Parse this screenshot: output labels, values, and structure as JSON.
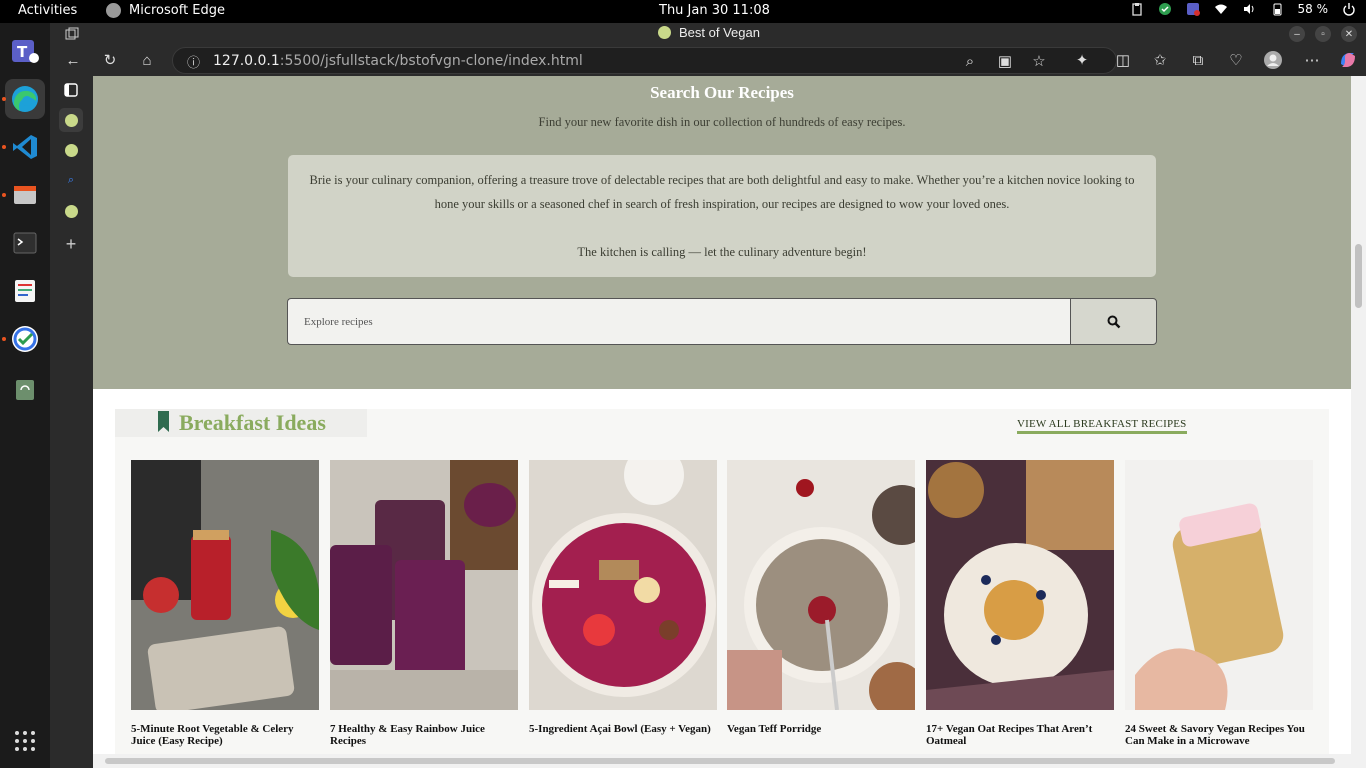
{
  "topbar": {
    "activities": "Activities",
    "app_name": "Microsoft Edge",
    "clock": "Thu Jan 30  11:08",
    "battery": "58 %"
  },
  "dock": {
    "items": [
      "teams-icon",
      "edge-icon",
      "vscode-icon",
      "files-icon",
      "terminal-icon",
      "document-viewer-icon",
      "ticktick-icon",
      "trash-icon",
      "app-grid-icon"
    ]
  },
  "browser": {
    "tab_title": "Best of Vegan",
    "url_host": "127.0.0.1",
    "url_rest": ":5500/jsfullstack/bstofvgn-clone/index.html"
  },
  "page": {
    "search": {
      "title": "Search Our Recipes",
      "subtitle": "Find your new favorite dish in our collection of hundreds of easy recipes.",
      "intro_p1": "Brie is your culinary companion, offering a treasure trove of delectable recipes that are both delightful and easy to make. Whether you’re a kitchen novice looking to hone your skills or a seasoned chef in search of fresh inspiration, our recipes are designed to wow your loved ones.",
      "intro_p2": "The kitchen is calling — let the culinary adventure begin!",
      "placeholder": "Explore recipes"
    },
    "breakfast": {
      "title": "Breakfast Ideas",
      "view_all": "VIEW ALL BREAKFAST RECIPES",
      "cards": [
        {
          "title": "5-Minute Root Vegetable & Celery Juice (Easy Recipe)"
        },
        {
          "title": "7 Healthy & Easy Rainbow Juice Recipes"
        },
        {
          "title": "5-Ingredient Açai Bowl (Easy + Vegan)"
        },
        {
          "title": "Vegan Teff Porridge"
        },
        {
          "title": "17+ Vegan Oat Recipes That Aren’t Oatmeal"
        },
        {
          "title": "24 Sweet & Savory Vegan Recipes You Can Make in a Microwave"
        }
      ]
    }
  },
  "colors": {
    "search_bg": "#a6ab98",
    "accent_green": "#8aab5e",
    "bookmark_green": "#2f6b4f"
  }
}
